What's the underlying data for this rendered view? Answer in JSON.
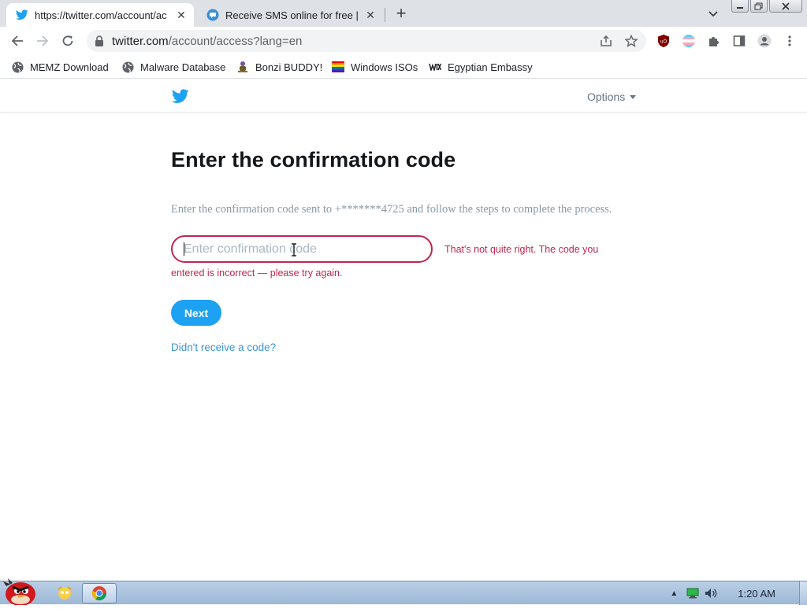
{
  "browser": {
    "tabs": [
      {
        "title": "https://twitter.com/account/ac",
        "active": true,
        "favicon": "twitter-icon"
      },
      {
        "title": "Receive SMS online for free | T",
        "active": false,
        "favicon": "sms-chat-icon"
      }
    ],
    "new_tab_label": "+",
    "address": {
      "host": "twitter.com",
      "path": "/account/access?lang=en"
    },
    "bookmarks": [
      {
        "label": "MEMZ Download",
        "icon": "globe-icon"
      },
      {
        "label": "Malware Database",
        "icon": "globe-icon"
      },
      {
        "label": "Bonzi BUDDY!",
        "icon": "bonzi-icon"
      },
      {
        "label": "Windows ISOs",
        "icon": "rainbow-flag-icon"
      },
      {
        "label": "Egyptian Embassy",
        "icon": "wix-icon"
      }
    ]
  },
  "page": {
    "header": {
      "options_label": "Options"
    },
    "heading": "Enter the confirmation code",
    "description": "Enter the confirmation code sent to +*******4725 and follow the steps to complete the process.",
    "code_input": {
      "placeholder": "Enter confirmation code",
      "value": ""
    },
    "error": {
      "line1": "That's not quite right. The code you",
      "line2": "entered is incorrect — please try again."
    },
    "next_label": "Next",
    "resend_label": "Didn't receive a code?"
  },
  "taskbar": {
    "clock": "1:20 AM"
  },
  "colors": {
    "twitter_blue": "#1da1f2",
    "error_red": "#c0264d",
    "link_blue": "#3b94d9"
  }
}
